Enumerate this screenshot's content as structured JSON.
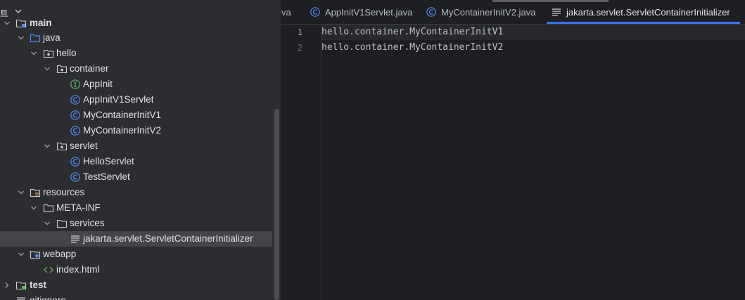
{
  "project_panel": {
    "title": "트",
    "rows": [
      {
        "label": "main",
        "icon": "module-folder-icon",
        "arrow": "down"
      },
      {
        "label": "java",
        "icon": "source-folder-icon",
        "arrow": "down"
      },
      {
        "label": "hello",
        "icon": "package-icon",
        "arrow": "down"
      },
      {
        "label": "container",
        "icon": "package-icon",
        "arrow": "down"
      },
      {
        "label": "AppInit",
        "icon": "interface-icon",
        "arrow": ""
      },
      {
        "label": "AppInitV1Servlet",
        "icon": "class-icon",
        "arrow": ""
      },
      {
        "label": "MyContainerInitV1",
        "icon": "class-icon",
        "arrow": ""
      },
      {
        "label": "MyContainerInitV2",
        "icon": "class-icon",
        "arrow": ""
      },
      {
        "label": "servlet",
        "icon": "package-icon",
        "arrow": "down"
      },
      {
        "label": "HelloServlet",
        "icon": "class-icon",
        "arrow": ""
      },
      {
        "label": "TestServlet",
        "icon": "class-icon",
        "arrow": ""
      },
      {
        "label": "resources",
        "icon": "resources-folder-icon",
        "arrow": "down"
      },
      {
        "label": "META-INF",
        "icon": "folder-icon",
        "arrow": "down"
      },
      {
        "label": "services",
        "icon": "folder-icon",
        "arrow": "down"
      },
      {
        "label": "jakarta.servlet.ServletContainerInitializer",
        "icon": "text-file-icon",
        "arrow": ""
      },
      {
        "label": "webapp",
        "icon": "web-folder-icon",
        "arrow": "down"
      },
      {
        "label": "index.html",
        "icon": "html-file-icon",
        "arrow": ""
      },
      {
        "label": "test",
        "icon": "module-folder-icon",
        "arrow": "right"
      },
      {
        "label": "gitignore",
        "icon": "text-file-icon",
        "arrow": ""
      }
    ]
  },
  "editor": {
    "tabs": [
      {
        "label": "va",
        "icon": ""
      },
      {
        "label": "AppInitV1Servlet.java",
        "icon": "class-icon"
      },
      {
        "label": "MyContainerInitV2.java",
        "icon": "class-icon"
      },
      {
        "label": "jakarta.servlet.ServletContainerInitializer",
        "icon": "text-file-icon"
      }
    ],
    "active_tab": "jakarta.servlet.ServletContainerInitializer",
    "lines": [
      {
        "number": "1",
        "text": "hello.container.MyContainerInitV1"
      },
      {
        "number": "2",
        "text": "hello.container.MyContainerInitV2"
      }
    ]
  },
  "colors": {
    "panel_bg": "#2b2d30",
    "editor_bg": "#1e1f22",
    "selection": "#43454a",
    "accent": "#3574f0",
    "class_icon": "#548af7",
    "interface_icon": "#5fb865"
  }
}
